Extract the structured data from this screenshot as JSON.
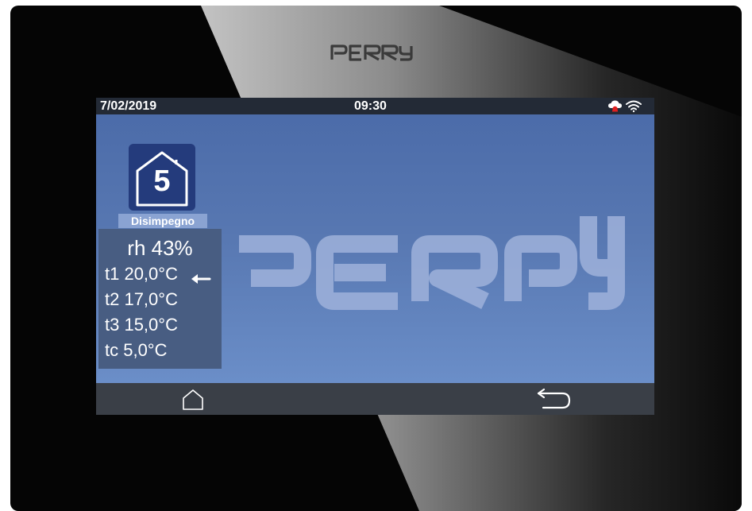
{
  "device": {
    "brand_logo": "PERRY"
  },
  "statusbar": {
    "date": "7/02/2019",
    "time": "09:30",
    "icons": [
      "cloud-alert-icon",
      "wifi-icon"
    ]
  },
  "screen": {
    "watermark": "PERRY"
  },
  "zone": {
    "number": "5",
    "name": "Disimpegno"
  },
  "readings": {
    "rh": "rh  43%",
    "t1": "t1 20,0°C",
    "t2": "t2 17,0°C",
    "t3": "t3 15,0°C",
    "tc": "tc  5,0°C",
    "active_indicator": "left-arrow-icon"
  },
  "navbar": {
    "home": "home-icon",
    "back": "back-icon"
  },
  "colors": {
    "device_body": "#050505",
    "status_bar": "#232a36",
    "screen_top": "#4a6aa8",
    "screen_bottom": "#6f93cd",
    "zone_tile": "#243b7c",
    "readings_panel": "#485d82",
    "navbar": "#3a3f47",
    "alert_red": "#e02020"
  }
}
